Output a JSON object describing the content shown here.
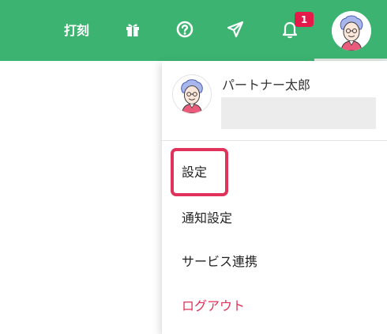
{
  "header": {
    "bg_color": "#3cb371",
    "punch_label": "打刻",
    "icons": [
      "gift-icon",
      "help-circle-icon",
      "send-icon",
      "bell-icon"
    ],
    "notification_count": "1",
    "badge_color": "#e6194b"
  },
  "dropdown": {
    "user_name": "パートナー太郎",
    "items": [
      {
        "label": "設定"
      },
      {
        "label": "通知設定"
      },
      {
        "label": "サービス連携"
      },
      {
        "label": "ログアウト",
        "color": "#e0325a"
      }
    ],
    "highlight_color": "#e0325a"
  }
}
